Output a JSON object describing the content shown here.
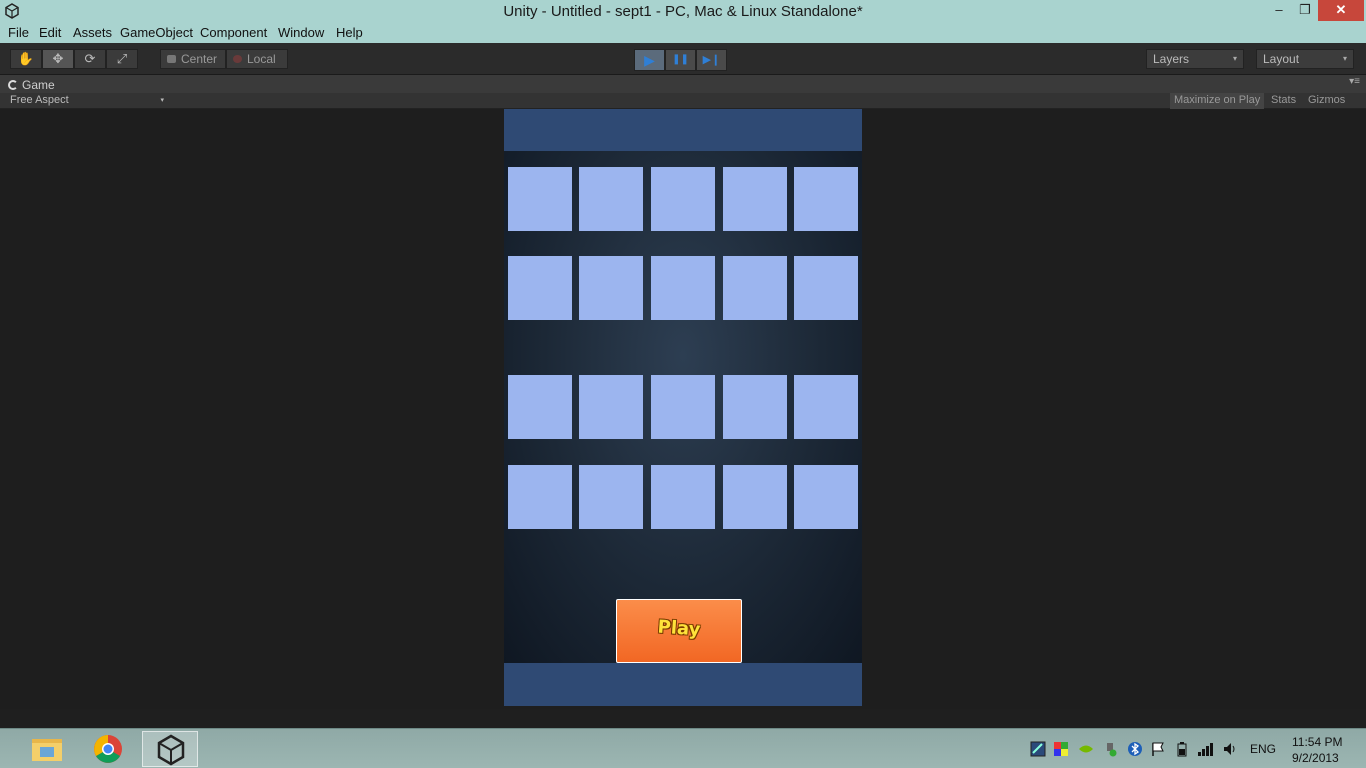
{
  "window": {
    "title": "Unity - Untitled - sept1 - PC, Mac & Linux Standalone*",
    "min_glyph": "–",
    "max_glyph": "❐",
    "close_glyph": "✕"
  },
  "menu": [
    "File",
    "Edit",
    "Assets",
    "GameObject",
    "Component",
    "Window",
    "Help"
  ],
  "toolbar": {
    "transform_tools": [
      {
        "name": "hand-tool",
        "glyph": "✋"
      },
      {
        "name": "move-tool",
        "glyph": "✥"
      },
      {
        "name": "rotate-tool",
        "glyph": "⟳"
      },
      {
        "name": "scale-tool",
        "glyph": "⤢"
      }
    ],
    "active_tool": "move-tool",
    "pivot_center": "Center",
    "pivot_local": "Local",
    "play_glyph": "▶",
    "pause_glyph": "❚❚",
    "step_glyph": "▶❙",
    "layers_label": "Layers",
    "layout_label": "Layout",
    "caret": "▾"
  },
  "game_panel": {
    "tab_label": "Game",
    "panel_menu_glyph": "▾≡",
    "aspect_label": "Free Aspect",
    "maximize_label": "Maximize on Play",
    "stats_label": "Stats",
    "gizmos_label": "Gizmos",
    "play_button_label": "Play",
    "tile_rows": 4,
    "tile_cols": 5
  },
  "taskbar": {
    "apps": [
      "file-explorer",
      "chrome",
      "unity"
    ],
    "active_app": "unity",
    "language": "ENG",
    "time": "11:54 PM",
    "date": "9/2/2013"
  },
  "colors": {
    "title_bar": "#a9d3cf",
    "tile": "#9cb5ef",
    "play_button": "#f26724",
    "game_band": "#2f4a74"
  }
}
